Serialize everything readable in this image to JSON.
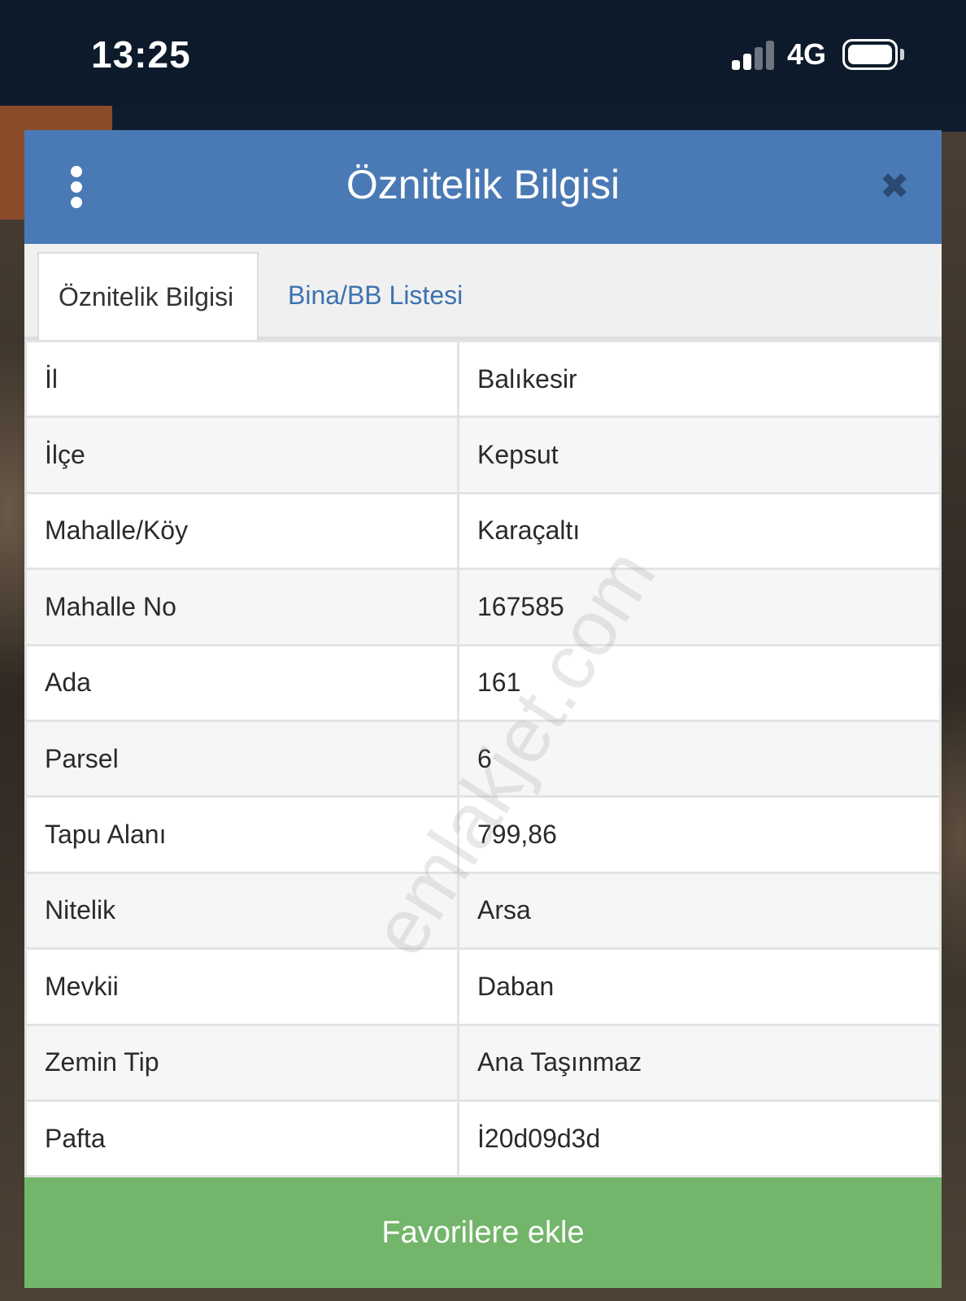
{
  "status_bar": {
    "time": "13:25",
    "network": "4G",
    "signal_bars_active": 2,
    "signal_bars_total": 4,
    "battery_level": 1.0
  },
  "dialog": {
    "title": "Öznitelik Bilgisi",
    "menu_icon": "vertical-dots-icon",
    "close_icon": "close-icon",
    "close_glyph": "✖",
    "header_color": "#4a7ab5"
  },
  "tabs": [
    {
      "label": "Öznitelik Bilgisi",
      "active": true
    },
    {
      "label": "Bina/BB Listesi",
      "active": false
    }
  ],
  "attributes": [
    {
      "label": "İl",
      "value": "Balıkesir"
    },
    {
      "label": "İlçe",
      "value": "Kepsut"
    },
    {
      "label": "Mahalle/Köy",
      "value": "Karaçaltı"
    },
    {
      "label": "Mahalle No",
      "value": "167585"
    },
    {
      "label": "Ada",
      "value": "161"
    },
    {
      "label": "Parsel",
      "value": "6"
    },
    {
      "label": "Tapu Alanı",
      "value": "799,86"
    },
    {
      "label": "Nitelik",
      "value": "Arsa"
    },
    {
      "label": "Mevkii",
      "value": "Daban"
    },
    {
      "label": "Zemin Tip",
      "value": "Ana Taşınmaz"
    },
    {
      "label": "Pafta",
      "value": "İ20d09d3d"
    }
  ],
  "favorite_button": {
    "label": "Favorilere ekle",
    "color": "#73b56a"
  },
  "watermark": "emlakjet.com"
}
